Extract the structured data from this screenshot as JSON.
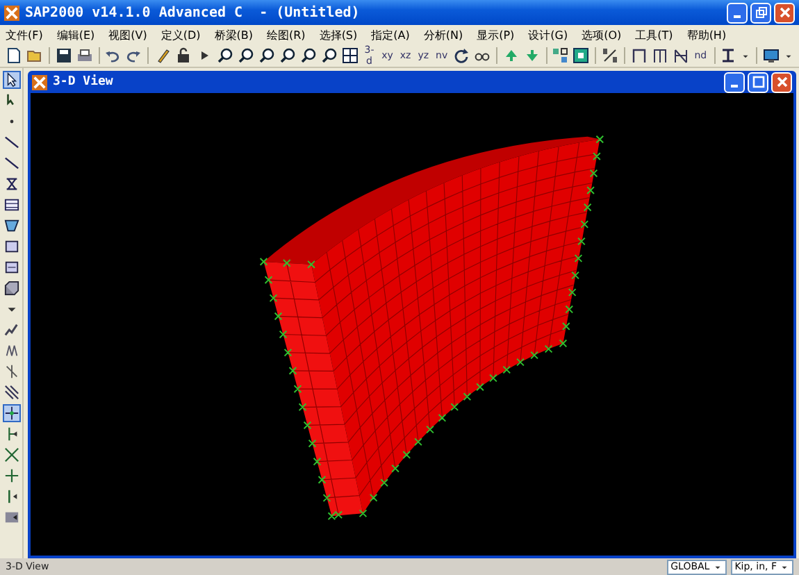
{
  "window": {
    "title": "SAP2000 v14.1.0 Advanced C  - (Untitled)"
  },
  "menu": [
    {
      "label": "文件(F)"
    },
    {
      "label": "编辑(E)"
    },
    {
      "label": "视图(V)"
    },
    {
      "label": "定义(D)"
    },
    {
      "label": "桥梁(B)"
    },
    {
      "label": "绘图(R)"
    },
    {
      "label": "选择(S)"
    },
    {
      "label": "指定(A)"
    },
    {
      "label": "分析(N)"
    },
    {
      "label": "显示(P)"
    },
    {
      "label": "设计(G)"
    },
    {
      "label": "选项(O)"
    },
    {
      "label": "工具(T)"
    },
    {
      "label": "帮助(H)"
    }
  ],
  "toolbar": {
    "view_buttons": [
      "3-d",
      "xy",
      "xz",
      "yz",
      "nv"
    ],
    "extra_button": "nd"
  },
  "left_toolbar": [
    {
      "selected": true
    },
    {
      "selected": false
    },
    {
      "selected": false
    },
    {
      "selected": false
    },
    {
      "selected": false
    },
    {
      "selected": false
    },
    {
      "selected": false
    },
    {
      "selected": false
    },
    {
      "selected": false
    },
    {
      "selected": false
    },
    {
      "selected": false
    },
    {
      "selected": false
    },
    {
      "selected": false
    },
    {
      "selected": false
    },
    {
      "selected": false
    },
    {
      "selected": false
    },
    {
      "selected": true
    },
    {
      "selected": false
    },
    {
      "selected": false
    },
    {
      "selected": false
    },
    {
      "selected": false
    },
    {
      "selected": false
    }
  ],
  "view_window": {
    "title": "3-D View"
  },
  "status_bar": {
    "text": "3-D View",
    "coordinate_system": "GLOBAL",
    "units": "Kip, in, F"
  }
}
